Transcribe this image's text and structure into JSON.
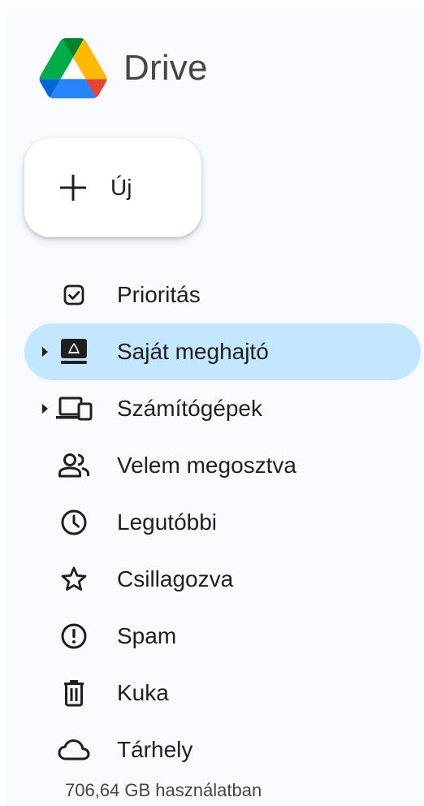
{
  "app": {
    "title": "Drive"
  },
  "new_button": {
    "label": "Új",
    "icon": "plus-icon"
  },
  "nav": {
    "items": [
      {
        "label": "Prioritás",
        "icon": "priority-checkbox-icon",
        "active": false,
        "expandable": false
      },
      {
        "label": "Saját meghajtó",
        "icon": "my-drive-icon",
        "active": true,
        "expandable": true
      },
      {
        "label": "Számítógépek",
        "icon": "computers-icon",
        "active": false,
        "expandable": true
      },
      {
        "label": "Velem megosztva",
        "icon": "shared-people-icon",
        "active": false,
        "expandable": false
      },
      {
        "label": "Legutóbbi",
        "icon": "clock-icon",
        "active": false,
        "expandable": false
      },
      {
        "label": "Csillagozva",
        "icon": "star-icon",
        "active": false,
        "expandable": false
      },
      {
        "label": "Spam",
        "icon": "spam-icon",
        "active": false,
        "expandable": false
      },
      {
        "label": "Kuka",
        "icon": "trash-icon",
        "active": false,
        "expandable": false
      },
      {
        "label": "Tárhely",
        "icon": "cloud-icon",
        "active": false,
        "expandable": false
      }
    ]
  },
  "storage": {
    "usage_text": "706,64 GB használatban"
  },
  "colors": {
    "sidebar_bg": "#f8fafd",
    "active_bg": "#c2e7ff",
    "text": "#1f1f1f",
    "muted_text": "#444746"
  }
}
